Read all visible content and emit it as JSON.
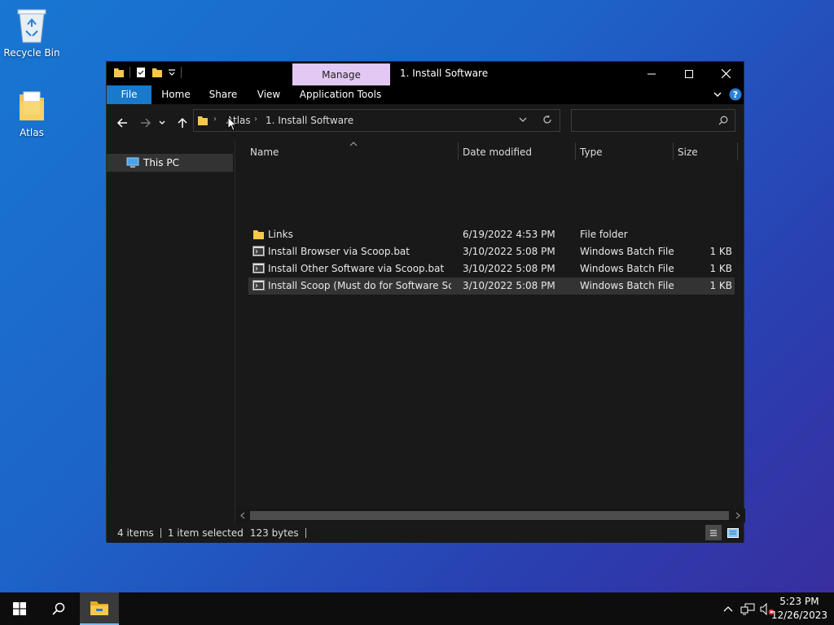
{
  "desktop": {
    "icons": [
      {
        "label": "Recycle Bin"
      },
      {
        "label": "Atlas"
      }
    ]
  },
  "window": {
    "title": "1. Install Software",
    "context_tab": "Manage",
    "ribbon_tabs": [
      "File",
      "Home",
      "Share",
      "View",
      "Application Tools"
    ],
    "breadcrumb": [
      "Atlas",
      "1. Install Software"
    ],
    "search_placeholder": "",
    "nav_pane": {
      "items": [
        "This PC"
      ]
    },
    "columns": {
      "name": "Name",
      "date": "Date modified",
      "type": "Type",
      "size": "Size"
    },
    "files": [
      {
        "name": "Links",
        "date": "6/19/2022 4:53 PM",
        "type": "File folder",
        "size": "",
        "icon": "folder-icon"
      },
      {
        "name": "Install Browser via Scoop.bat",
        "date": "3/10/2022 5:08 PM",
        "type": "Windows Batch File",
        "size": "1 KB",
        "icon": "batch-file-icon"
      },
      {
        "name": "Install Other Software via Scoop.bat",
        "date": "3/10/2022 5:08 PM",
        "type": "Windows Batch File",
        "size": "1 KB",
        "icon": "batch-file-icon"
      },
      {
        "name": "Install Scoop (Must do for Software Scrip...",
        "date": "3/10/2022 5:08 PM",
        "type": "Windows Batch File",
        "size": "1 KB",
        "icon": "batch-file-icon",
        "selected": true
      }
    ],
    "status": {
      "items": "4 items",
      "selected": "1 item selected",
      "size": "123 bytes"
    }
  },
  "taskbar": {
    "time": "5:23 PM",
    "date": "12/26/2023"
  },
  "colors": {
    "accent": "#1979ca",
    "manage_tab": "#e2c8f3",
    "folder": "#f5c84a"
  }
}
